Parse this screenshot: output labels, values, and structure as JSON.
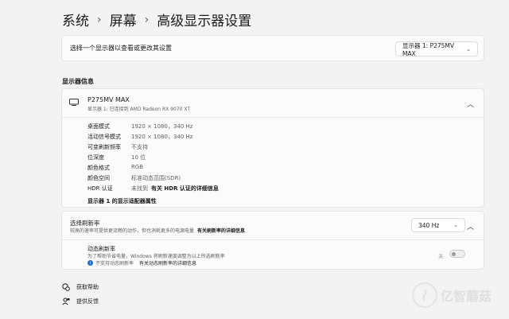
{
  "breadcrumb": {
    "items": [
      "系统",
      "屏幕",
      "高级显示器设置"
    ],
    "separator": "›"
  },
  "display_select": {
    "label": "选择一个显示器以查看或更改其设置",
    "value": "显示器 1: P275MV MAX"
  },
  "section_title": "显示器信息",
  "display_info": {
    "name": "P275MV MAX",
    "subtitle": "显示器 1: 已连接到 AMD Radeon RX 9070 XT",
    "rows": [
      {
        "key": "桌面模式",
        "value": "1920 × 1080，340 Hz"
      },
      {
        "key": "活动信号模式",
        "value": "1920 × 1080，340 Hz"
      },
      {
        "key": "可变刷新频率",
        "value": "不支持"
      },
      {
        "key": "位深度",
        "value": "10 位"
      },
      {
        "key": "颜色格式",
        "value": "RGB"
      },
      {
        "key": "颜色空间",
        "value": "标准动态范围(SDR)"
      },
      {
        "key": "HDR 认证",
        "value": "未找到",
        "link": "有关 HDR 认证的详细信息"
      }
    ],
    "adapter_link": "显示器 1 的显示适配器属性"
  },
  "refresh_rate": {
    "title": "选择刷新率",
    "description": "较高的速率可提供更流畅的动作，但也消耗更多的电源电量",
    "link": "有关刷新率的详细信息",
    "value": "340 Hz"
  },
  "dynamic_refresh": {
    "title": "动态刷新率",
    "description": "为了帮助节省电量，Windows 将刷新速度调整为以上所选刷新率",
    "warning": "不支持动态刷新率",
    "warning_link": "有关动态刷新率的详细信息",
    "toggle_label": "关",
    "toggle_on": false
  },
  "footer": {
    "help": "获取帮助",
    "feedback": "提供反馈"
  },
  "watermark": {
    "text": "亿智蘑菇"
  },
  "colors": {
    "background": "#f3f3f3",
    "card": "#fbfbfb",
    "accent": "#1c6fd1"
  }
}
